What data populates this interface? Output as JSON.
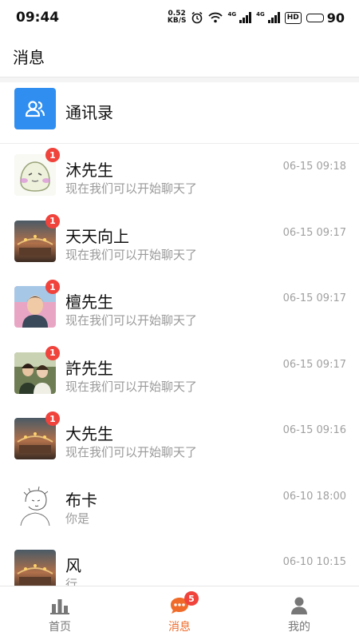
{
  "status_bar": {
    "time": "09:44",
    "net_speed_value": "0.52",
    "net_speed_unit": "KB/S",
    "network_type": "4G",
    "hd_label": "HD",
    "battery": "90"
  },
  "header": {
    "title": "消息"
  },
  "contacts": {
    "label": "通讯录",
    "icon": "contacts-icon"
  },
  "conversations": [
    {
      "name": "沐先生",
      "preview": "现在我们可以开始聊天了",
      "time": "06-15 09:18",
      "badge": "1"
    },
    {
      "name": "天天向上",
      "preview": "现在我们可以开始聊天了",
      "time": "06-15 09:17",
      "badge": "1"
    },
    {
      "name": "檀先生",
      "preview": "现在我们可以开始聊天了",
      "time": "06-15 09:17",
      "badge": "1"
    },
    {
      "name": "許先生",
      "preview": "现在我们可以开始聊天了",
      "time": "06-15 09:17",
      "badge": "1"
    },
    {
      "name": "大先生",
      "preview": "现在我们可以开始聊天了",
      "time": "06-15 09:16",
      "badge": "1"
    },
    {
      "name": "布卡",
      "preview": "你是",
      "time": "06-10 18:00",
      "badge": ""
    },
    {
      "name": "风",
      "preview": "行",
      "time": "06-10 10:15",
      "badge": ""
    }
  ],
  "tabbar": {
    "home_label": "首页",
    "messages_label": "消息",
    "messages_badge": "5",
    "mine_label": "我的",
    "active_color": "#f06b2a",
    "inactive_color": "#777777"
  },
  "colors": {
    "accent_blue": "#2f8ef0",
    "badge_red": "#f0433c"
  }
}
